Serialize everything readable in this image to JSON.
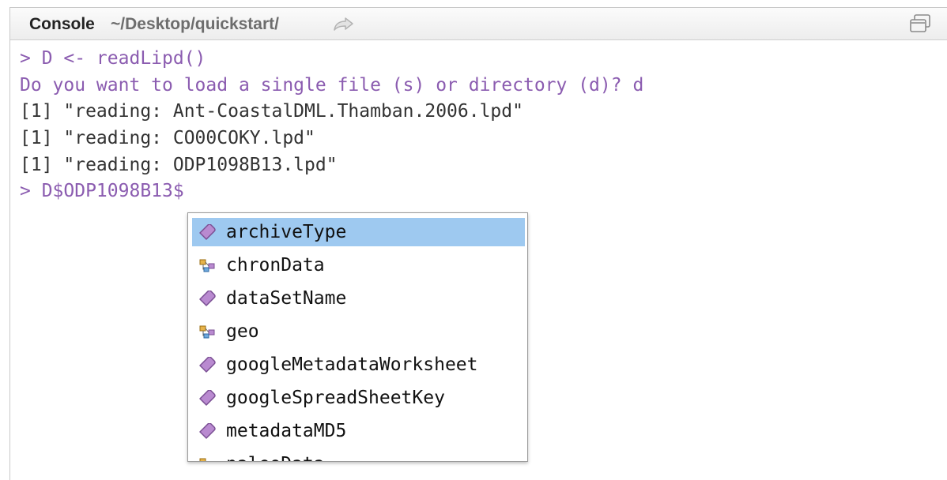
{
  "pane": {
    "title": "Console",
    "path": "~/Desktop/quickstart/",
    "goto_icon": "arrow-right-icon",
    "maximize_icon": "maximize-icon"
  },
  "console": {
    "lines": [
      {
        "text": "> D <- readLipd()",
        "kind": "command"
      },
      {
        "text": "Do you want to load a single file (s) or directory (d)? d",
        "kind": "command"
      },
      {
        "text": "[1] \"reading: Ant-CoastalDML.Thamban.2006.lpd\"",
        "kind": "output"
      },
      {
        "text": "[1] \"reading: CO00COKY.lpd\"",
        "kind": "output"
      },
      {
        "text": "[1] \"reading: ODP1098B13.lpd\"",
        "kind": "output"
      },
      {
        "text": "> D$ODP1098B13$",
        "kind": "command"
      }
    ]
  },
  "autocomplete": {
    "selected_index": 0,
    "items": [
      {
        "label": "archiveType",
        "icon": "tag-icon"
      },
      {
        "label": "chronData",
        "icon": "list-structure-icon"
      },
      {
        "label": "dataSetName",
        "icon": "tag-icon"
      },
      {
        "label": "geo",
        "icon": "list-structure-icon"
      },
      {
        "label": "googleMetadataWorksheet",
        "icon": "tag-icon"
      },
      {
        "label": "googleSpreadSheetKey",
        "icon": "tag-icon"
      },
      {
        "label": "metadataMD5",
        "icon": "tag-icon"
      },
      {
        "label": "paleoData",
        "icon": "list-structure-icon"
      }
    ]
  },
  "colors": {
    "command_text": "#8b5cb0",
    "output_text": "#333333",
    "selection": "#9ec9f0"
  }
}
